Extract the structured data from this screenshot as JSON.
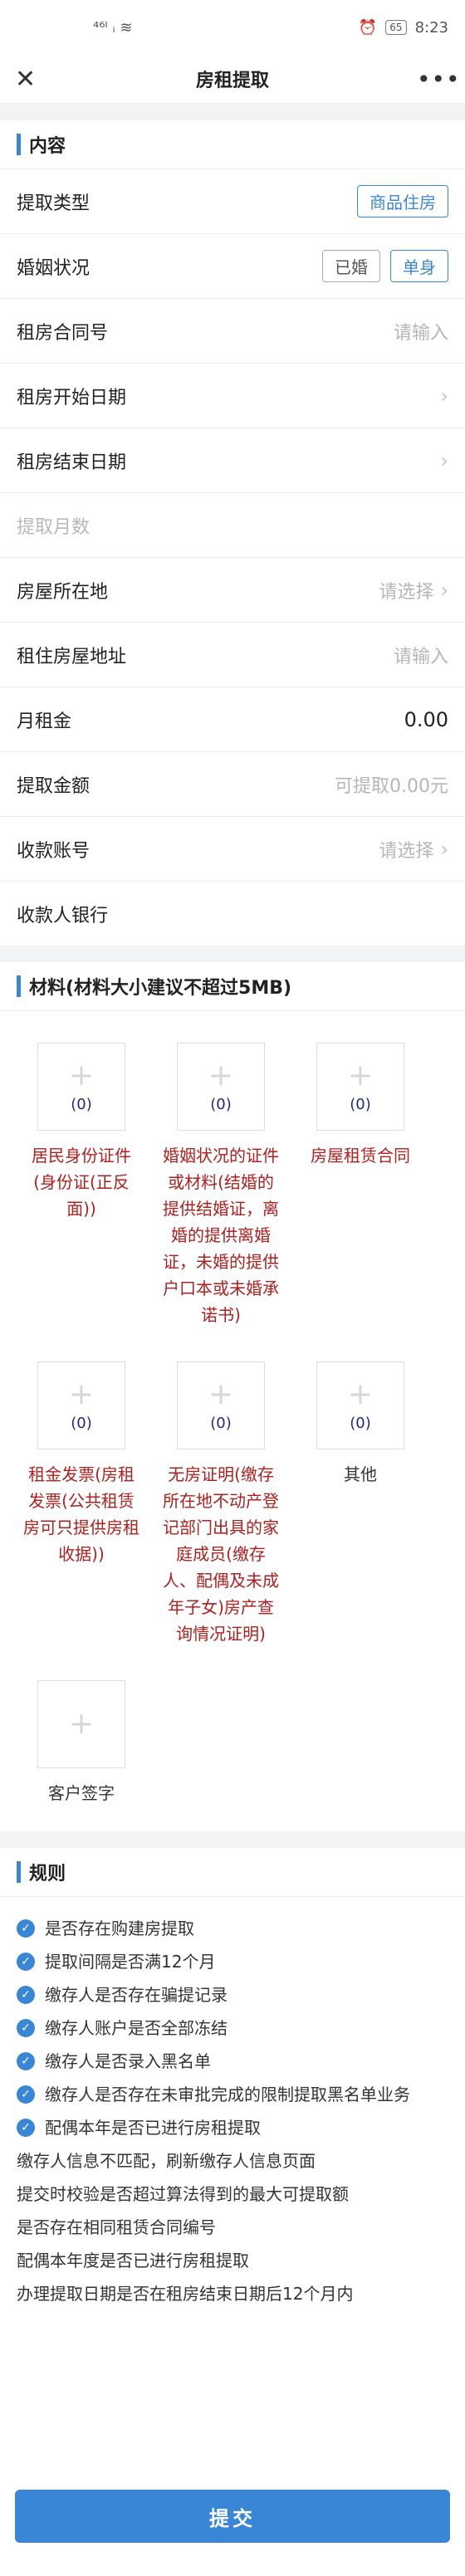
{
  "statusbar": {
    "signal": "⁴⁶ᴵ ᵢ ≋",
    "battery": "65",
    "time": "8:23"
  },
  "nav": {
    "close": "✕",
    "title": "房租提取",
    "more": "•••"
  },
  "content": {
    "heading": "内容",
    "type_label": "提取类型",
    "type_value": "商品住房",
    "marital_label": "婚姻状况",
    "marital_options": [
      "已婚",
      "单身"
    ],
    "contract_label": "租房合同号",
    "contract_placeholder": "请输入",
    "start_label": "租房开始日期",
    "end_label": "租房结束日期",
    "months_label": "提取月数",
    "location_label": "房屋所在地",
    "location_placeholder": "请选择",
    "address_label": "租住房屋地址",
    "address_placeholder": "请输入",
    "rent_label": "月租金",
    "rent_value": "0.00",
    "amount_label": "提取金额",
    "amount_placeholder": "可提取0.00元",
    "account_label": "收款账号",
    "account_placeholder": "请选择",
    "bank_label": "收款人银行"
  },
  "materials": {
    "heading": "材料(材料大小建议不超过5MB)",
    "items": [
      {
        "count": "(0)",
        "name": "居民身份证件(身份证(正反面))"
      },
      {
        "count": "(0)",
        "name": "婚姻状况的证件或材料(结婚的提供结婚证，离婚的提供离婚证，未婚的提供户口本或未婚承诺书)"
      },
      {
        "count": "(0)",
        "name": "房屋租赁合同"
      },
      {
        "count": "(0)",
        "name": "租金发票(房租发票(公共租赁房可只提供房租收据))"
      },
      {
        "count": "(0)",
        "name": "无房证明(缴存所在地不动产登记部门出具的家庭成员(缴存人、配偶及未成年子女)房产查询情况证明)"
      },
      {
        "count": "(0)",
        "name": "其他"
      },
      {
        "count": "",
        "name": "客户签字"
      }
    ]
  },
  "rules": {
    "heading": "规则",
    "checked": [
      "是否存在购建房提取",
      "提取间隔是否满12个月",
      "缴存人是否存在骗提记录",
      "缴存人账户是否全部冻结",
      "缴存人是否录入黑名单",
      "缴存人是否存在未审批完成的限制提取黑名单业务",
      "配偶本年是否已进行房租提取"
    ],
    "plain": [
      "缴存人信息不匹配，刷新缴存人信息页面",
      "提交时校验是否超过算法得到的最大可提取额",
      "是否存在相同租赁合同编号",
      "配偶本年度是否已进行房租提取",
      "办理提取日期是否在租房结束日期后12个月内"
    ]
  },
  "submit_label": "提交"
}
